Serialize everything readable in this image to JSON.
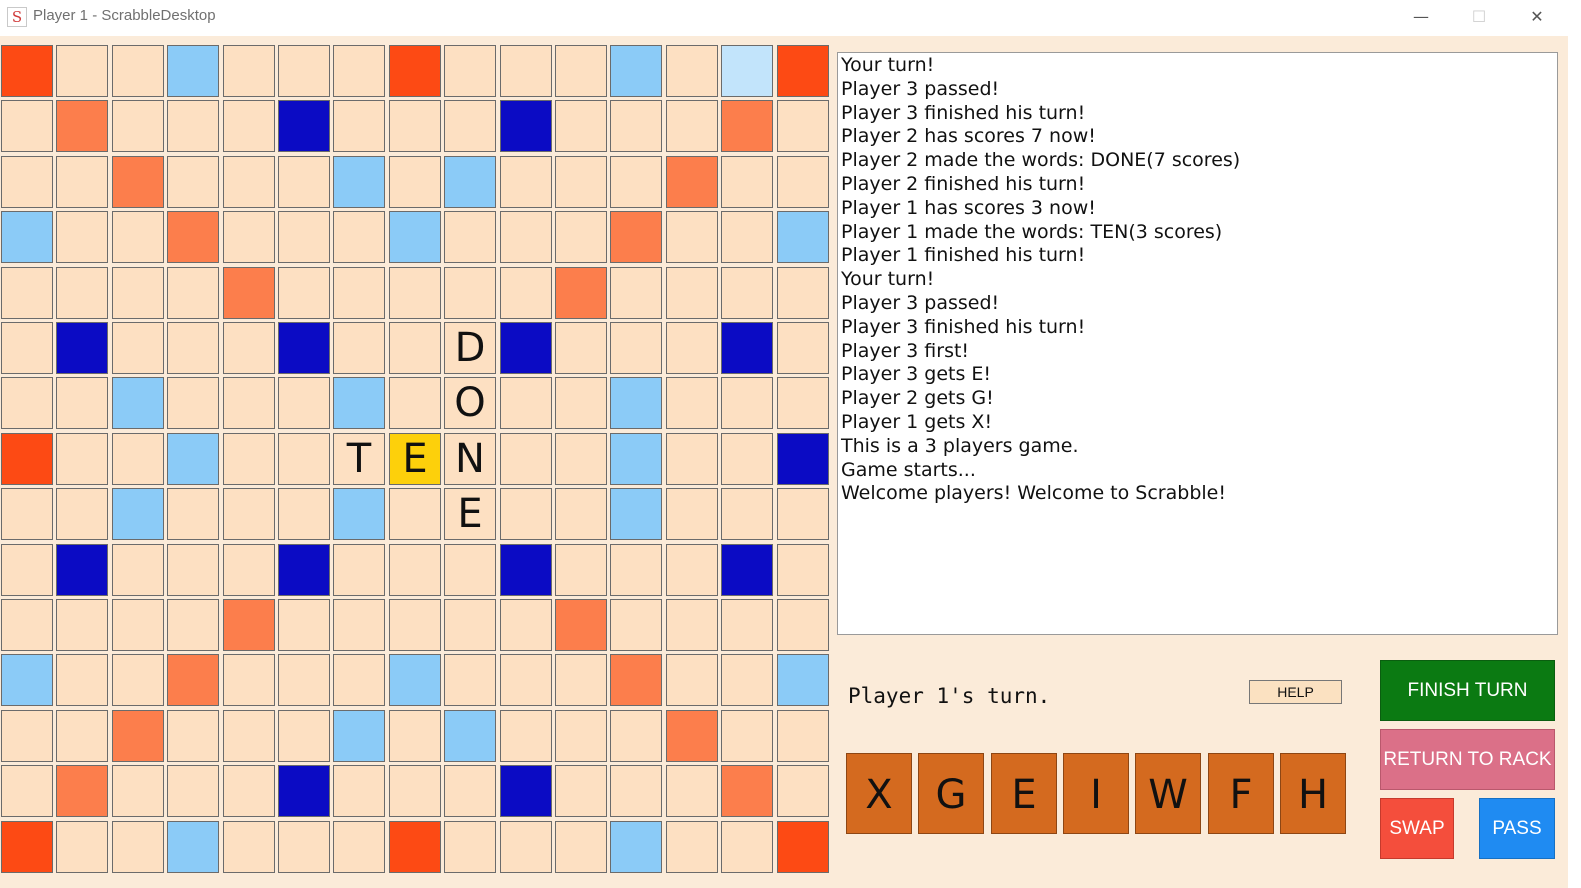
{
  "window": {
    "title": "Player 1 - ScrabbleDesktop",
    "icon_letter": "S",
    "minimize_glyph": "—",
    "maximize_glyph": "☐",
    "close_glyph": "✕"
  },
  "board": {
    "rows": [
      "RNNLNNNRNNNLNIR",
      "NPNNNDNNNDNNNPN",
      "NNPNNNLNLNNNPNN",
      "LNNPNNNLNNNPNNL",
      "NNNNPNNNNNPNNNN",
      "NDNNNDNNNDNNNDN",
      "NNLNNNLNNNNLNNN",
      "RNNLNNNYNNNLNND",
      "NNLNNNLNNNNLNNN",
      "NDNNNDNNNDNNNDN",
      "NNNNPNNNNNPNNNN",
      "LNNPNNNLNNNPNNL",
      "NNPNNNLNLNNNPNN",
      "NPNNNDNNNDNNNPN",
      "RNNLNNNRNNNLNNR"
    ],
    "placed_tiles": [
      {
        "row": 5,
        "col": 8,
        "letter": "D"
      },
      {
        "row": 6,
        "col": 8,
        "letter": "O"
      },
      {
        "row": 7,
        "col": 6,
        "letter": "T"
      },
      {
        "row": 7,
        "col": 7,
        "letter": "E"
      },
      {
        "row": 7,
        "col": 8,
        "letter": "N"
      },
      {
        "row": 8,
        "col": 8,
        "letter": "E"
      }
    ],
    "colors": {
      "normal": "#fde0c2",
      "light_blue": "#8bcbf7",
      "dark_blue": "#0b0bc4",
      "pink": "#fc7e4c",
      "red": "#fd4a14",
      "center_yellow": "#fdd00b"
    }
  },
  "log": [
    "Your turn!",
    "Player 3 passed!",
    "Player 3 finished his turn!",
    "Player 2 has scores 7 now!",
    "Player 2 made the words: DONE(7 scores)",
    "Player 2 finished his turn!",
    "Player 1 has scores 3 now!",
    "Player 1 made the words: TEN(3 scores)",
    "Player 1 finished his turn!",
    "Your turn!",
    "Player 3 passed!",
    "Player 3 finished his turn!",
    "Player 3 first!",
    "Player 3 gets E!",
    "Player 2 gets G!",
    "Player 1 gets X!",
    "This is a 3 players game.",
    "Game starts...",
    "Welcome players! Welcome to Scrabble!"
  ],
  "status": {
    "turn_text": "Player 1's turn."
  },
  "buttons": {
    "help": "HELP",
    "finish_turn": "FINISH TURN",
    "return_to_rack": "RETURN TO RACK",
    "swap": "SWAP",
    "pass": "PASS"
  },
  "rack": [
    "X",
    "G",
    "E",
    "I",
    "W",
    "F",
    "H"
  ]
}
